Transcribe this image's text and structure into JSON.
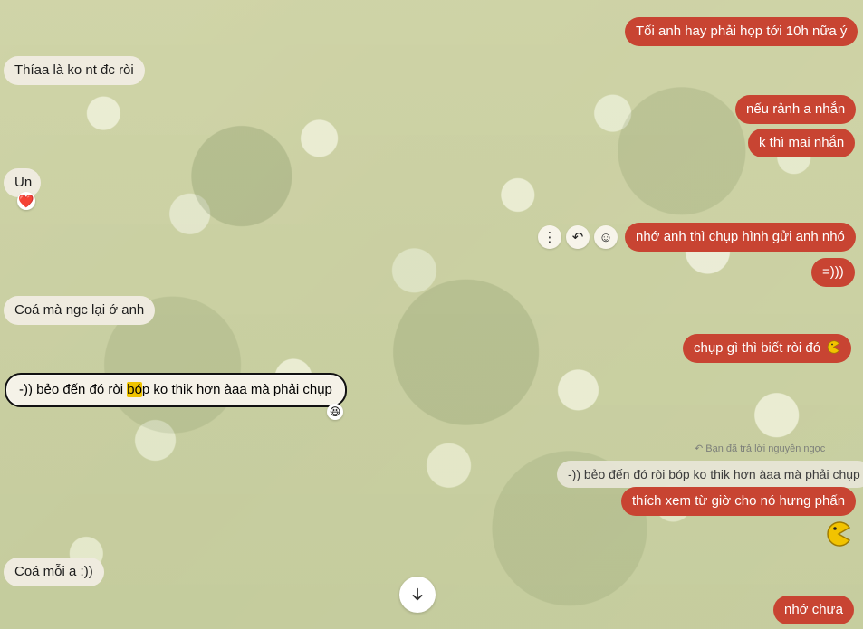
{
  "messages": {
    "m1": "Tối anh hay phải họp tới 10h nữa ý",
    "m2": "Thíaa là ko nt đc ròi",
    "m3": "nếu rảnh a nhắn",
    "m4": "k thì mai nhắn",
    "m5": "Un",
    "m6": "nhớ anh thì chụp hình gửi anh nhó",
    "m7": "=)))",
    "m8": "Coá mà ngc lại ớ anh",
    "m9": "chụp gì thì biết ròi đó",
    "m10_a": "-))  bẻo đến đó ròi ",
    "m10_b": "bó",
    "m10_c": "p ko thik hơn àaa mà phải chụp",
    "reply_label": "Bạn đã trả lời nguyễn ngọc",
    "quoted": "-))  bẻo đến đó ròi bóp ko thik hơn àaa mà phải chụp",
    "m11": "thích xem từ giờ cho nó hưng phấn",
    "m12": "Coá mỗi a :))",
    "m13": "nhớ chưa"
  },
  "icons": {
    "heart": "❤️",
    "laugh": "😆",
    "pacman": "pacman"
  },
  "colors": {
    "outgoing": "#c84432",
    "incoming": "#efebdf"
  }
}
